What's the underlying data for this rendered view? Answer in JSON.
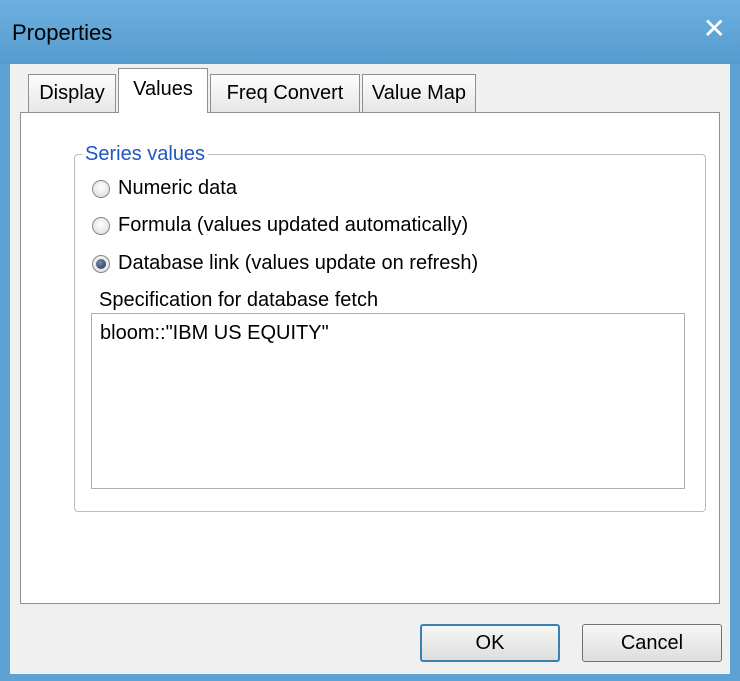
{
  "window": {
    "title": "Properties"
  },
  "tabs": [
    {
      "label": "Display"
    },
    {
      "label": "Values",
      "active": true
    },
    {
      "label": "Freq Convert"
    },
    {
      "label": "Value Map"
    }
  ],
  "series_values": {
    "group_label": "Series values",
    "options": [
      {
        "label": "Numeric data",
        "checked": false
      },
      {
        "label": "Formula  (values updated automatically)",
        "checked": false
      },
      {
        "label": "Database link (values update on refresh)",
        "checked": true
      }
    ]
  },
  "spec": {
    "label": "Specification for database fetch",
    "value": "bloom::\"IBM US EQUITY\""
  },
  "buttons": {
    "ok": "OK",
    "cancel": "Cancel"
  },
  "colors": {
    "titlebar": "#5da2d3",
    "group_label": "#1f56c4"
  }
}
